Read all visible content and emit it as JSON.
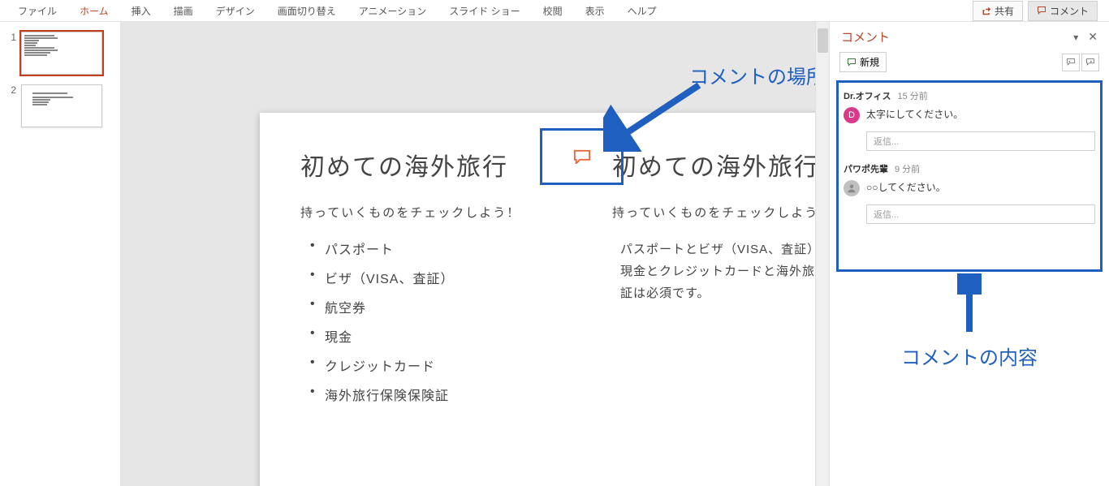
{
  "ribbon": {
    "tabs": [
      "ファイル",
      "ホーム",
      "挿入",
      "描画",
      "デザイン",
      "画面切り替え",
      "アニメーション",
      "スライド ショー",
      "校閲",
      "表示",
      "ヘルプ"
    ],
    "share_label": "共有",
    "comment_label": "コメント"
  },
  "thumbs": [
    {
      "num": "1"
    },
    {
      "num": "2"
    }
  ],
  "slide": {
    "left": {
      "title": "初めての海外旅行",
      "subtitle": "持っていくものをチェックしよう！",
      "items": [
        "パスポート",
        "ビザ（VISA、査証）",
        "航空券",
        "現金",
        "クレジットカード",
        "海外旅行保険保険証"
      ]
    },
    "right": {
      "title": "初めての海外旅行",
      "subtitle": "持っていくものをチェックしよう！",
      "para": "パスポートとビザ（VISA、査証）と航空券と現金とクレジットカードと海外旅行保険保険証は必須です。"
    }
  },
  "annotations": {
    "location_label": "コメントの場所",
    "content_label": "コメントの内容"
  },
  "comments_pane": {
    "title": "コメント",
    "new_label": "新規",
    "reply_placeholder": "返信...",
    "items": [
      {
        "author": "Dr.オフィス",
        "time": "15 分前",
        "text": "太字にしてください。",
        "avatar": "D",
        "avatar_class": "d"
      },
      {
        "author": "パワポ先輩",
        "time": "9 分前",
        "text": "○○してください。",
        "avatar": "",
        "avatar_class": "g"
      }
    ]
  }
}
